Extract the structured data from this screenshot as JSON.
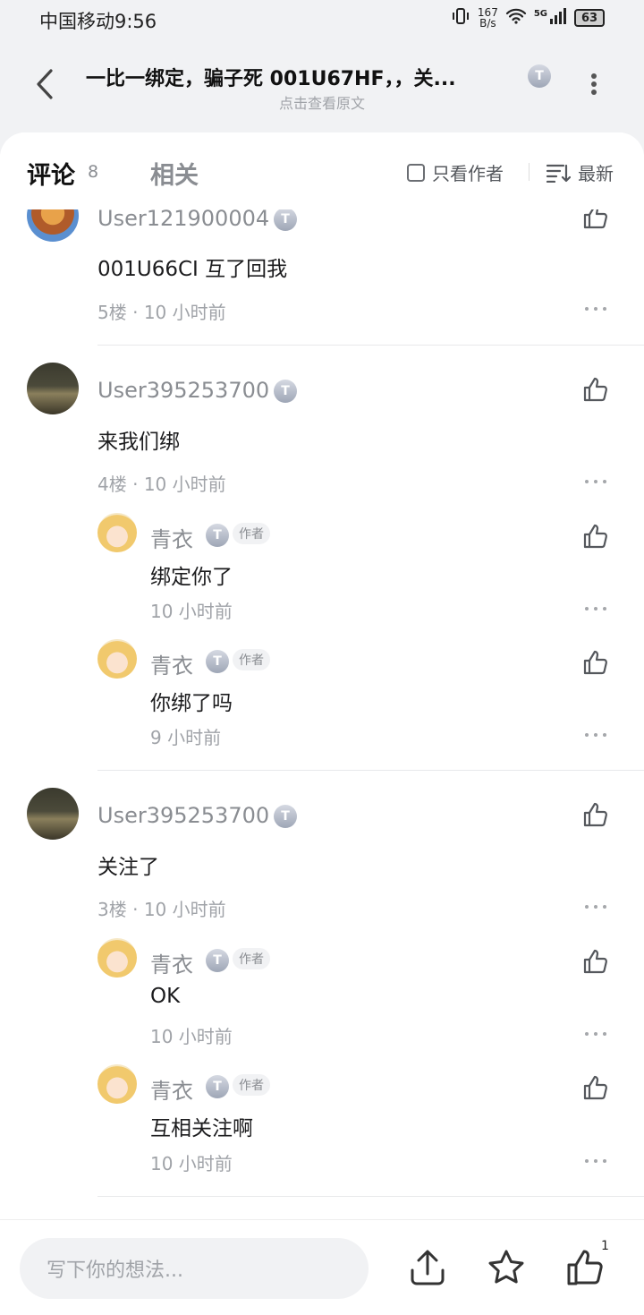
{
  "status": {
    "carrier_time": "中国移动9:56",
    "speed": "167\nB/s",
    "net": "5G",
    "battery": "63"
  },
  "header": {
    "title": "一比一绑定，骗子死 001U67HF，，关...",
    "subtitle": "点击查看原文",
    "badge": "T"
  },
  "tabs": {
    "comments": "评论",
    "comments_count": "8",
    "related": "相关",
    "author_only": "只看作者",
    "sort": "最新"
  },
  "comments": [
    {
      "user": "User121900004",
      "text": "001U66CI 互了回我",
      "floor": "5楼",
      "time": "10 小时前",
      "avatar": "clash-avatar",
      "replies": []
    },
    {
      "user": "User395253700",
      "text": "来我们绑",
      "floor": "4楼",
      "time": "10 小时前",
      "avatar": "road-avatar",
      "replies": [
        {
          "user": "青衣",
          "tag": "作者",
          "text": "绑定你了",
          "time": "10 小时前"
        },
        {
          "user": "青衣",
          "tag": "作者",
          "text": "你绑了吗",
          "time": "9 小时前"
        }
      ]
    },
    {
      "user": "User395253700",
      "text": "关注了",
      "floor": "3楼",
      "time": "10 小时前",
      "avatar": "road-avatar",
      "replies": [
        {
          "user": "青衣",
          "tag": "作者",
          "text": "OK",
          "time": "10 小时前"
        },
        {
          "user": "青衣",
          "tag": "作者",
          "text": "互相关注啊",
          "time": "10 小时前"
        }
      ]
    }
  ],
  "bottom": {
    "placeholder": "写下你的想法...",
    "like_count": "1"
  },
  "meta_sep": " · "
}
